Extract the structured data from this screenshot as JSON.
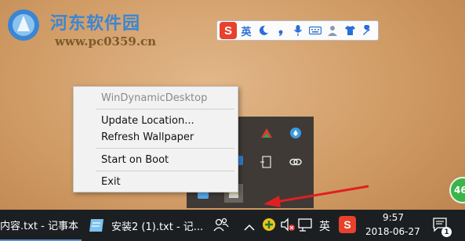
{
  "watermark": {
    "title": "河东软件园",
    "url": "www.pc0359.cn"
  },
  "ime_toolbar": {
    "logo": "S",
    "mode": "英",
    "icons": [
      "moon-icon",
      "comma-icon",
      "microphone-icon",
      "keyboard-icon",
      "user-icon",
      "shirt-icon",
      "wrench-icon"
    ]
  },
  "context_menu": {
    "header": "WinDynamicDesktop",
    "items": [
      "Update Location...",
      "Refresh Wallpaper",
      "Start on Boot",
      "Exit"
    ]
  },
  "taskbar": {
    "task1": "内容.txt - 记事本",
    "task2": "安装2 (1).txt - 记...",
    "ime_indicator": "英",
    "time": "9:57",
    "date": "2018-06-27",
    "notification_count": "1",
    "badge_text": "46"
  },
  "colors": {
    "accent": "#3a86d4",
    "taskbar": "#1c1f22",
    "flyout": "#3f3a36",
    "arrow": "#e02020"
  }
}
